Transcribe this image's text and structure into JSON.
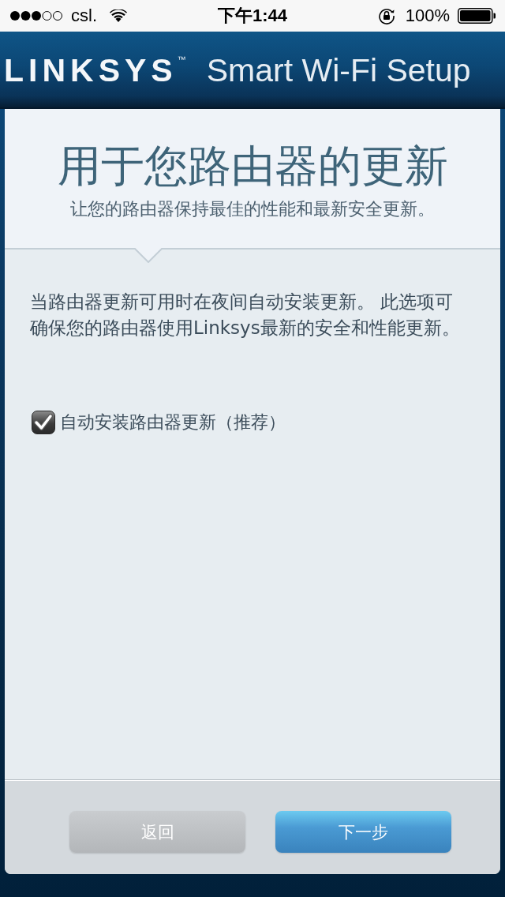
{
  "status_bar": {
    "carrier": "csl.",
    "time": "下午1:44",
    "battery": "100%"
  },
  "header": {
    "logo": "LINKSYS$^{™}$",
    "app_title": "Smart Wi-Fi Setup"
  },
  "intro": {
    "title": "用于您路由器的更新",
    "subtitle": "让您的路由器保持最佳的性能和最新安全更新。"
  },
  "description": "当路由器更新可用时在夜间自动安装更新。 此选项可确保您的路由器使用Linksys最新的安全和性能更新。",
  "auto_update": {
    "label": "自动安装路由器更新（推荐）",
    "checked": true
  },
  "buttons": [
    {
      "label": "返回",
      "kind": "secondary"
    },
    {
      "label": "下一步",
      "kind": "primary"
    }
  ]
}
